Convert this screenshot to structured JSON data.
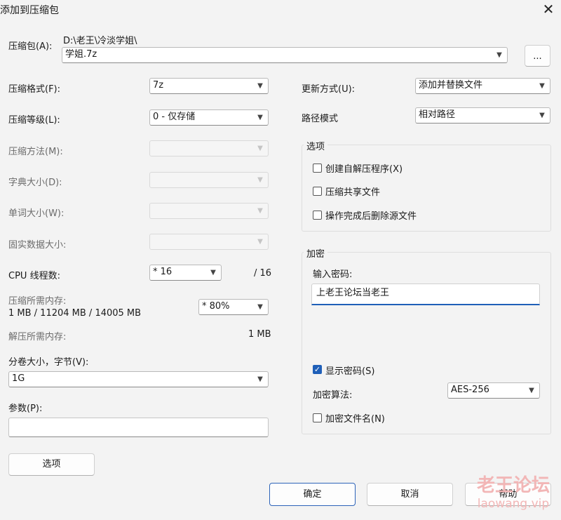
{
  "dialog": {
    "title": "添加到压缩包",
    "close_glyph": "✕"
  },
  "archive": {
    "label": "压缩包(A):",
    "path": "D:\\老王\\冷淡学姐\\",
    "name": "学姐.7z",
    "browse_label": "..."
  },
  "left": {
    "format": {
      "label": "压缩格式(F):",
      "value": "7z"
    },
    "level": {
      "label": "压缩等级(L):",
      "value": "0 - 仅存储"
    },
    "method": {
      "label": "压缩方法(M):",
      "value": ""
    },
    "dict": {
      "label": "字典大小(D):",
      "value": ""
    },
    "word": {
      "label": "单词大小(W):",
      "value": ""
    },
    "solid": {
      "label": "固实数据大小:",
      "value": ""
    },
    "cpu": {
      "label": "CPU 线程数:",
      "value": "* 16",
      "max": "/ 16"
    },
    "mem_compress": {
      "label": "压缩所需内存:",
      "detail": "1 MB / 11204 MB / 14005 MB",
      "value": "* 80%"
    },
    "mem_decompress": {
      "label": "解压所需内存:",
      "value": "1 MB"
    },
    "volume": {
      "label": "分卷大小，字节(V):",
      "value": "1G"
    },
    "params": {
      "label": "参数(P):",
      "value": ""
    },
    "options_button": "选项"
  },
  "right": {
    "update": {
      "label": "更新方式(U):",
      "value": "添加并替换文件"
    },
    "path_mode": {
      "label": "路径模式",
      "value": "相对路径"
    },
    "options_group": {
      "title": "选项",
      "sfx": "创建自解压程序(X)",
      "shared": "压缩共享文件",
      "delete": "操作完成后删除源文件"
    },
    "encryption": {
      "title": "加密",
      "password_label": "输入密码:",
      "password_value": "上老王论坛当老王",
      "show_password": "显示密码(S)",
      "method_label": "加密算法:",
      "method_value": "AES-256",
      "encrypt_names": "加密文件名(N)"
    }
  },
  "footer": {
    "ok": "确定",
    "cancel": "取消",
    "help": "帮助"
  },
  "watermark": {
    "line1": "老王论坛",
    "line2": "laowang.vip"
  },
  "icons": {
    "dropdown": "chevron-down-icon",
    "check": "checkmark-icon"
  }
}
